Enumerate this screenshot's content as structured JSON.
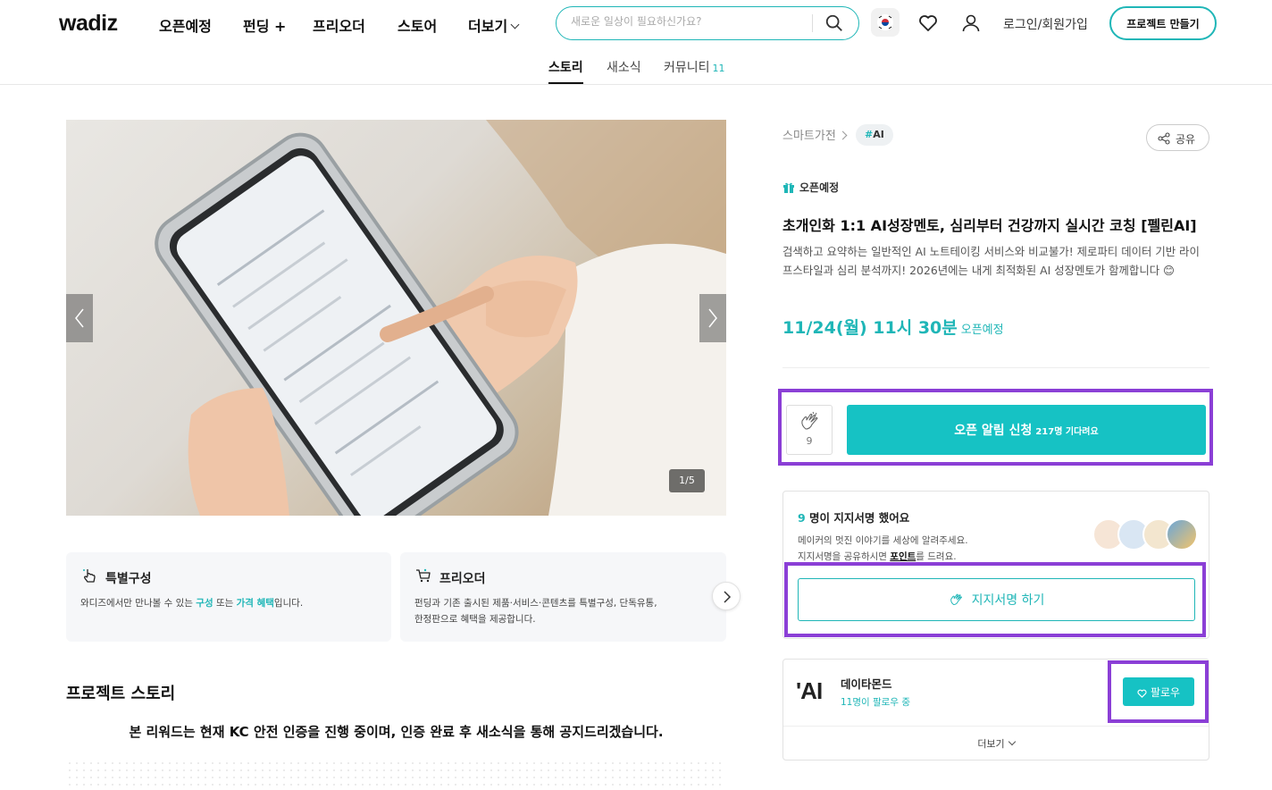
{
  "header": {
    "logo": "wadiz",
    "nav": [
      "오픈예정",
      "펀딩 +",
      "프리오더",
      "스토어",
      "더보기"
    ],
    "search_placeholder": "새로운 일상이 필요하신가요?",
    "login": "로그인/회원가입",
    "make_project": "프로젝트 만들기"
  },
  "subnav": {
    "story": "스토리",
    "news": "새소식",
    "community": "커뮤니티",
    "community_count": "11"
  },
  "gallery": {
    "counter": "1/5"
  },
  "features": [
    {
      "title": "특별구성",
      "desc_pre": "와디즈에서만 만나볼 수 있는 ",
      "hl1": "구성",
      "desc_mid": " 또는 ",
      "hl2": "가격 혜택",
      "desc_post": "입니다."
    },
    {
      "title": "프리오더",
      "desc_line1": "펀딩과 기존 출시된 제품·서비스·콘텐츠를 특별구성, 단독유통,",
      "desc_line2": "한정판으로 혜택을 제공합니다."
    }
  ],
  "story": {
    "title": "프로젝트 스토리",
    "notice": "본 리워드는 현재 KC 안전 인증을 진행 중이며, 인증 완료 후 새소식을 통해 공지드리겠습니다."
  },
  "project": {
    "category": "스마트가전",
    "tag": "AI",
    "share": "공유",
    "status": "오픈예정",
    "title": "초개인화 1:1 AI성장멘토, 심리부터 건강까지 실시간 코칭 [펠린AI]",
    "subtitle": "검색하고 요약하는 일반적인 AI 노트테이킹 서비스와 비교불가! 제로파티 데이터 기반 라이프스타일과 심리 분석까지! 2026년에는 내게 최적화된 AI 성장멘토가 함께합니다 😊",
    "open_date": "11/24(월) 11시 30분",
    "open_label": "오픈예정"
  },
  "actions": {
    "clap_count": "9",
    "alarm_label": "오픈 알림 신청",
    "alarm_wait": "217명 기다려요"
  },
  "signature": {
    "count": "9",
    "count_suffix": " 명이 지지서명 했어요",
    "desc_line1": "메이커의 멋진 이야기를 세상에 알려주세요.",
    "desc_pre": "지지서명을 공유하시면 ",
    "desc_bold": "포인트",
    "desc_post": "를 드려요.",
    "button": "지지서명 하기"
  },
  "maker": {
    "logo_text": "'AI",
    "name": "데이타몬드",
    "followers": "11명이 팔로우 중",
    "follow": "팔로우",
    "more": "더보기"
  },
  "colors": {
    "accent": "#16c2c4",
    "highlight_box": "#8b3fd6"
  }
}
